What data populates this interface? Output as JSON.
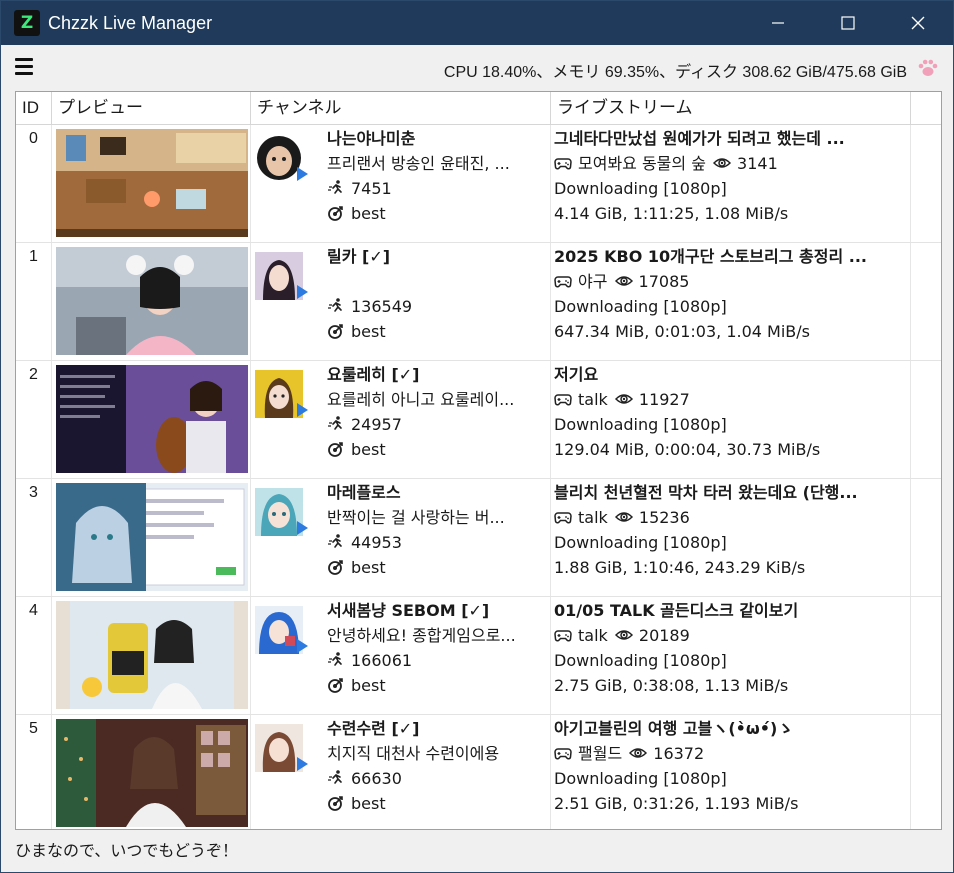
{
  "window": {
    "title": "Chzzk Live Manager",
    "icon": "chzzk-logo-icon"
  },
  "toolbar": {
    "status": "CPU 18.40%、メモリ 69.35%、ディスク 308.62 GiB/475.68 GiB"
  },
  "table": {
    "headers": {
      "id": "ID",
      "preview": "プレビュー",
      "channel": "チャンネル",
      "live": "ライブストリーム"
    },
    "rows": [
      {
        "id": "0",
        "channel_name": "나는야나미춘",
        "description": "프리랜서 방송인 윤태진, ...",
        "followers": "7451",
        "quality": "best",
        "live_title": "그네타다만났섭 원예가가 되려고 했는데 ...",
        "category": "모여봐요 동물의 숲",
        "viewers": "3141",
        "download_status": "Downloading [1080p]",
        "download_stats": "4.14 GiB, 1:11:25, 1.08 MiB/s"
      },
      {
        "id": "1",
        "channel_name": "릴카 [✓]",
        "description": "",
        "followers": "136549",
        "quality": "best",
        "live_title": "2025 KBO 10개구단 스토브리그 총정리 ...",
        "category": "야구",
        "viewers": "17085",
        "download_status": "Downloading [1080p]",
        "download_stats": "647.34 MiB, 0:01:03, 1.04 MiB/s"
      },
      {
        "id": "2",
        "channel_name": "요룰레히 [✓]",
        "description": "요를레히 아니고 요룰레이...",
        "followers": "24957",
        "quality": "best",
        "live_title": "저기요",
        "category": "talk",
        "viewers": "11927",
        "download_status": "Downloading [1080p]",
        "download_stats": "129.04 MiB, 0:00:04, 30.73 MiB/s"
      },
      {
        "id": "3",
        "channel_name": "마레플로스",
        "description": "반짝이는 걸 사랑하는 버...",
        "followers": "44953",
        "quality": "best",
        "live_title": "블리치 천년혈전 막차 타러 왔는데요 (단행...",
        "category": "talk",
        "viewers": "15236",
        "download_status": "Downloading [1080p]",
        "download_stats": "1.88 GiB, 1:10:46, 243.29 KiB/s"
      },
      {
        "id": "4",
        "channel_name": "서새봄냥 SEBOM [✓]",
        "description": "안녕하세요! 종합게임으로...",
        "followers": "166061",
        "quality": "best",
        "live_title": "01/05 TALK 골든디스크 같이보기",
        "category": "talk",
        "viewers": "20189",
        "download_status": "Downloading [1080p]",
        "download_stats": "2.75 GiB, 0:38:08, 1.13 MiB/s"
      },
      {
        "id": "5",
        "channel_name": "수련수련 [✓]",
        "description": "치지직 대천사 수련이에용",
        "followers": "66630",
        "quality": "best",
        "live_title": "아기고블린의 여행 고블ヽ(•̀ω•́)ゝ",
        "category": "팰월드",
        "viewers": "16372",
        "download_status": "Downloading [1080p]",
        "download_stats": "2.51 GiB, 0:31:26, 1.193 MiB/s"
      }
    ]
  },
  "footer": {
    "text": "ひまなので、いつでもどうぞ！"
  },
  "icons": {
    "followers": "runner-icon",
    "quality": "target-icon",
    "category": "gamepad-icon",
    "viewers": "eye-icon"
  },
  "colors": {
    "titlebar": "#1f3a5a",
    "accent": "#2d7be0",
    "paw": "#f0a0b8"
  }
}
